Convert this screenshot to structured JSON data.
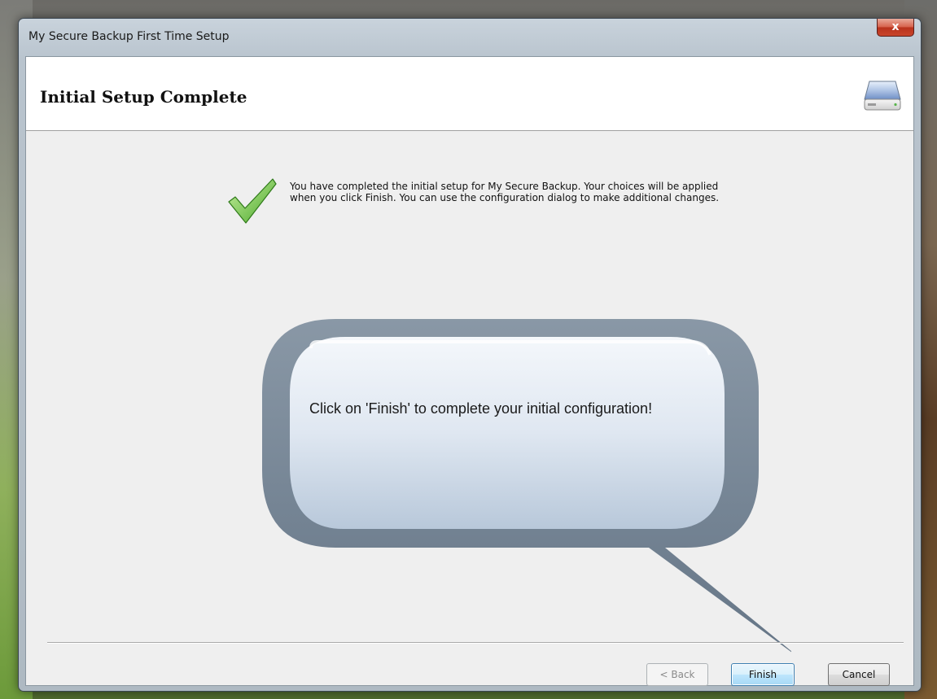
{
  "window": {
    "title": "My Secure Backup First Time Setup",
    "close_glyph": "x"
  },
  "header": {
    "title": "Initial Setup Complete",
    "icon": "drive-icon"
  },
  "content": {
    "status_icon": "checkmark-icon",
    "message": "You have completed the initial setup for My Secure Backup.  Your choices will be applied when you click Finish.  You can use the configuration dialog to make additional changes."
  },
  "callout": {
    "text": "Click on 'Finish' to complete your initial configuration!"
  },
  "buttons": {
    "back": "< Back",
    "finish": "Finish",
    "cancel": "Cancel"
  },
  "colors": {
    "check": "#6cc13a",
    "callout_fill": "#dde6f0",
    "finish_border": "#3c7fb1"
  }
}
